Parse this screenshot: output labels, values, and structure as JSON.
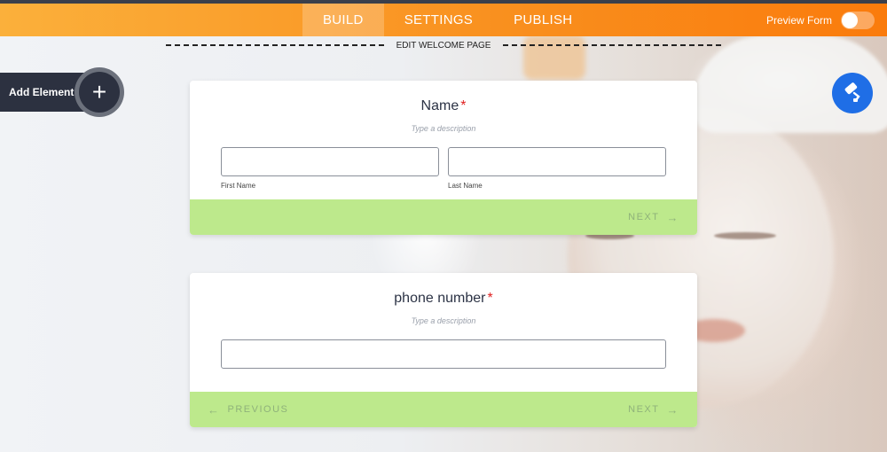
{
  "topbar": {
    "tabs": [
      {
        "label": "BUILD",
        "active": true
      },
      {
        "label": "SETTINGS",
        "active": false
      },
      {
        "label": "PUBLISH",
        "active": false
      }
    ],
    "preview_label": "Preview Form",
    "preview_on": false
  },
  "welcome": {
    "label": "EDIT WELCOME PAGE"
  },
  "add_element": {
    "label": "Add Element",
    "icon": "plus-icon"
  },
  "fab": {
    "icon": "paint-roller-icon"
  },
  "questions": [
    {
      "title": "Name",
      "required_mark": "*",
      "description": "Type a description",
      "fields": [
        {
          "sublabel": "First Name",
          "value": ""
        },
        {
          "sublabel": "Last Name",
          "value": ""
        }
      ],
      "next_label": "NEXT"
    },
    {
      "title": "phone number",
      "required_mark": "*",
      "description": "Type a description",
      "fields": [
        {
          "value": ""
        }
      ],
      "previous_label": "PREVIOUS",
      "next_label": "NEXT"
    }
  ],
  "colors": {
    "topbar_start": "#fbb03b",
    "topbar_end": "#fa7b0c",
    "nav_bar": "#bde98c",
    "fab": "#1f6ee6",
    "add_element": "#2c3140",
    "required": "#e02020"
  }
}
